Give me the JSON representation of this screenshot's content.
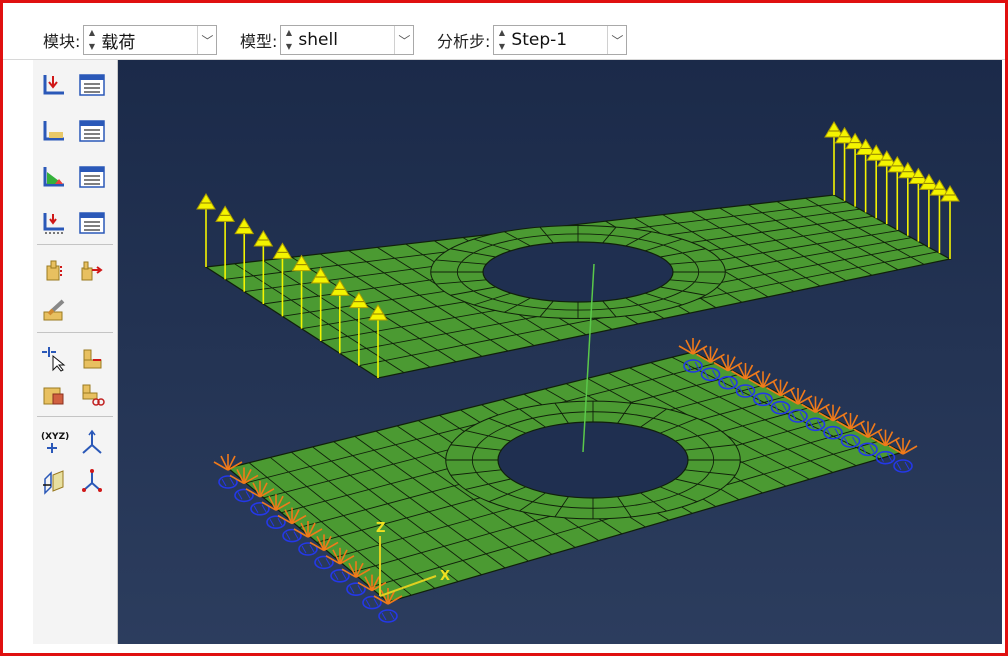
{
  "toolbar": {
    "module": {
      "label": "模块:",
      "value": "载荷"
    },
    "model": {
      "label": "模型:",
      "value": "shell"
    },
    "step": {
      "label": "分析步:",
      "value": "Step-1"
    }
  },
  "palette": {
    "tools": [
      "create-load",
      "load-manager",
      "create-boundary-condition",
      "bc-manager",
      "create-predefined-field",
      "field-manager",
      "create-load-case",
      "load-case-manager",
      "create-special-setting",
      "special-setting-manager",
      "create-edit-tool",
      "datum-point-tool",
      "partition-tool",
      "feature-tool",
      "partition-edit-tool",
      "create-csys-tool",
      "datum-axis-tool",
      "datum-plane-tool",
      "datum-csys-tool"
    ]
  },
  "viewport": {
    "background_top": "#1b2a49",
    "background_bottom": "#2c3d5e",
    "mesh_color": "#4b9a32",
    "load_color": "#f4f400",
    "bc_color_orange": "#f07a1a",
    "bc_color_blue": "#2438e8",
    "triad": {
      "x_label": "X",
      "z_label": "Z"
    }
  }
}
